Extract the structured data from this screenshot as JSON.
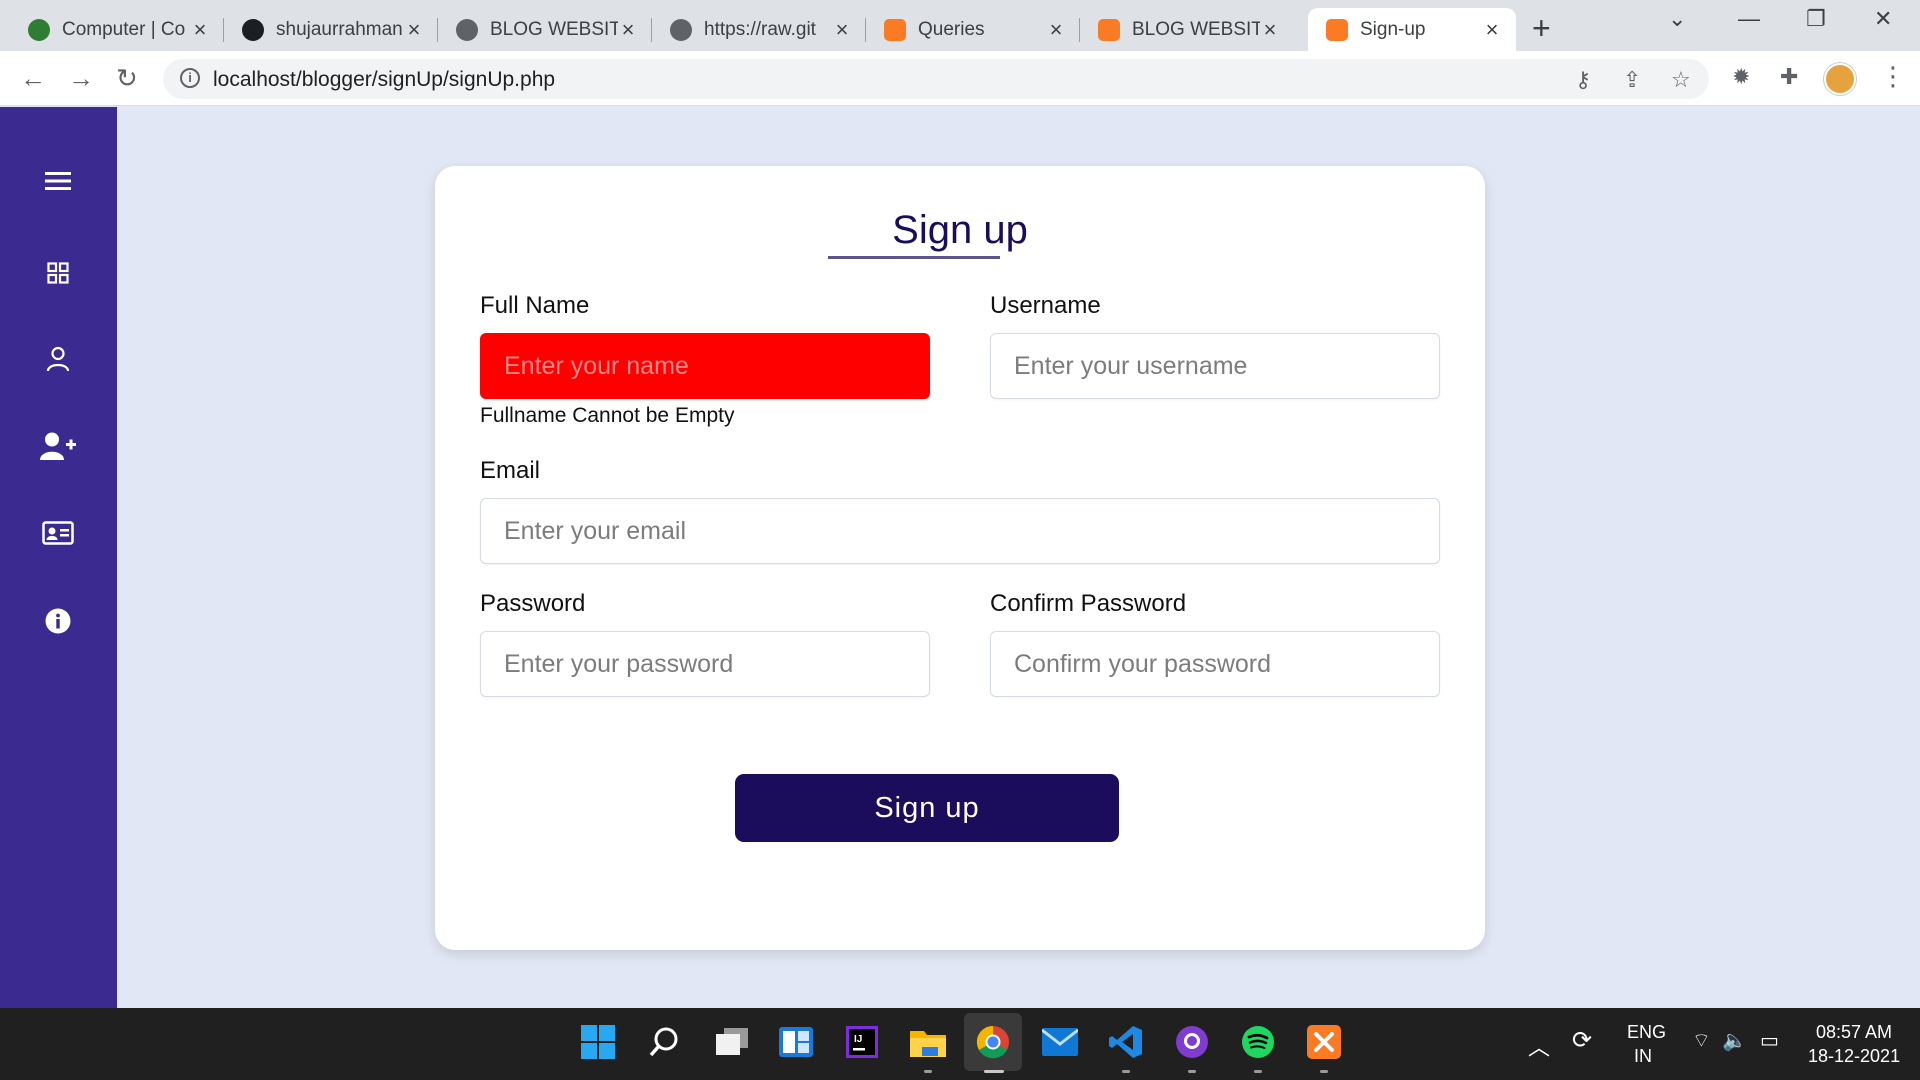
{
  "browser": {
    "tabs": [
      {
        "title": "Computer | Co",
        "icon": "tree-icon"
      },
      {
        "title": "shujaurrahman",
        "icon": "github-icon"
      },
      {
        "title": "BLOG WEBSITE",
        "icon": "globe-icon"
      },
      {
        "title": "https://raw.git",
        "icon": "globe-icon"
      },
      {
        "title": "Queries",
        "icon": "xampp-icon"
      },
      {
        "title": "BLOG WEBSITE",
        "icon": "xampp-icon"
      },
      {
        "title": "Sign-up",
        "icon": "xampp-icon",
        "active": true
      }
    ],
    "url": "localhost/blogger/signUp/signUp.php"
  },
  "sidebar": {
    "items": [
      {
        "icon": "hamburger-menu-icon"
      },
      {
        "icon": "dashboard-grid-icon"
      },
      {
        "icon": "user-icon"
      },
      {
        "icon": "add-user-icon"
      },
      {
        "icon": "id-card-icon"
      },
      {
        "icon": "info-icon"
      }
    ],
    "bg_color": "#3b2a90"
  },
  "form": {
    "title": "Sign up",
    "full_name": {
      "label": "Full Name",
      "placeholder": "Enter your name",
      "value": "",
      "error": "Fullname Cannot be Empty"
    },
    "username": {
      "label": "Username",
      "placeholder": "Enter your username",
      "value": ""
    },
    "email": {
      "label": "Email",
      "placeholder": "Enter your email",
      "value": ""
    },
    "password": {
      "label": "Password",
      "placeholder": "Enter your password",
      "value": ""
    },
    "confirm_password": {
      "label": "Confirm Password",
      "placeholder": "Confirm your password",
      "value": ""
    },
    "submit_label": "Sign up",
    "accent_color": "#1b0d5c",
    "error_color": "#ff0000"
  },
  "taskbar": {
    "language": "ENG",
    "region": "IN",
    "time": "08:57 AM",
    "date": "18-12-2021"
  }
}
